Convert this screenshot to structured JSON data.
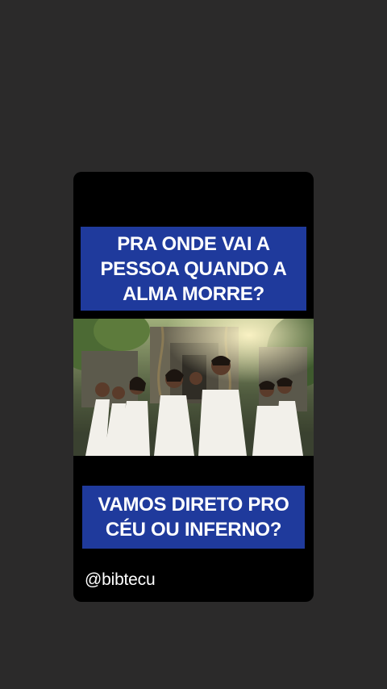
{
  "post": {
    "headline": "PRA ONDE VAI A\nPESSOA QUANDO A\nALMA MORRE?",
    "subheadline": "VAMOS DIRETO PRO\nCÉU OU INFERNO?",
    "handle": "@bibtecu"
  },
  "colors": {
    "page_background": "#2b2a2a",
    "card_background": "#000000",
    "banner": "#1f3a9c",
    "banner_text": "#ffffff"
  },
  "image": {
    "description_icon": "group-in-white-clothes-in-jungle-temple-photo"
  }
}
